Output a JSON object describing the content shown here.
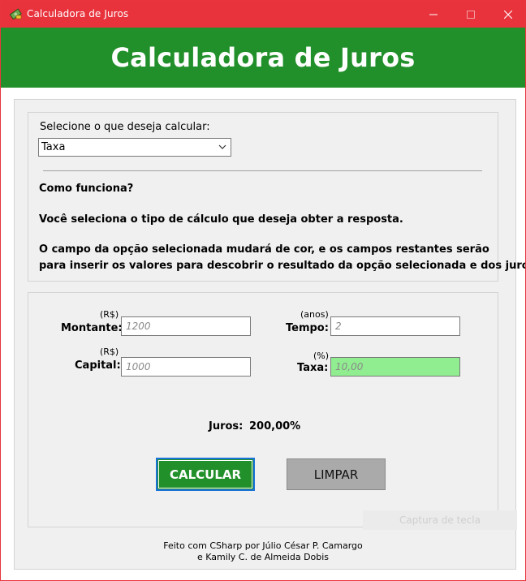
{
  "window": {
    "title": "Calculadora de Juros"
  },
  "header": {
    "title": "Calculadora de Juros"
  },
  "selector": {
    "label": "Selecione o que deseja calcular:",
    "value": "Taxa"
  },
  "help": {
    "heading": "Como funciona?",
    "line1": "Você seleciona o tipo de cálculo que deseja obter a resposta.",
    "line2": "O campo da opção selecionada mudará de cor, e os campos restantes serão",
    "line3": "para inserir os valores para descobrir o resultado da opção selecionada e dos juros."
  },
  "fields": {
    "montante": {
      "unit": "(R$)",
      "label": "Montante:",
      "value": "1200"
    },
    "capital": {
      "unit": "(R$)",
      "label": "Capital:",
      "value": "1000"
    },
    "tempo": {
      "unit": "(anos)",
      "label": "Tempo:",
      "value": "2"
    },
    "taxa": {
      "unit": "(%)",
      "label": "Taxa:",
      "value": "10,00"
    }
  },
  "result": {
    "label": "Juros:",
    "value": "200,00%"
  },
  "buttons": {
    "calcular": "CALCULAR",
    "limpar": "LIMPAR"
  },
  "ghost": {
    "text": "Captura de tecla"
  },
  "footer": {
    "line1": "Feito com CSharp por Júlio César P. Camargo",
    "line2": "e Kamily C. de Almeida Dobis"
  },
  "colors": {
    "titlebar": "#e8333d",
    "header": "#21902a",
    "highlight": "#90ee90",
    "calc_button": "#21902a",
    "limpar_button": "#aaaaaa"
  }
}
